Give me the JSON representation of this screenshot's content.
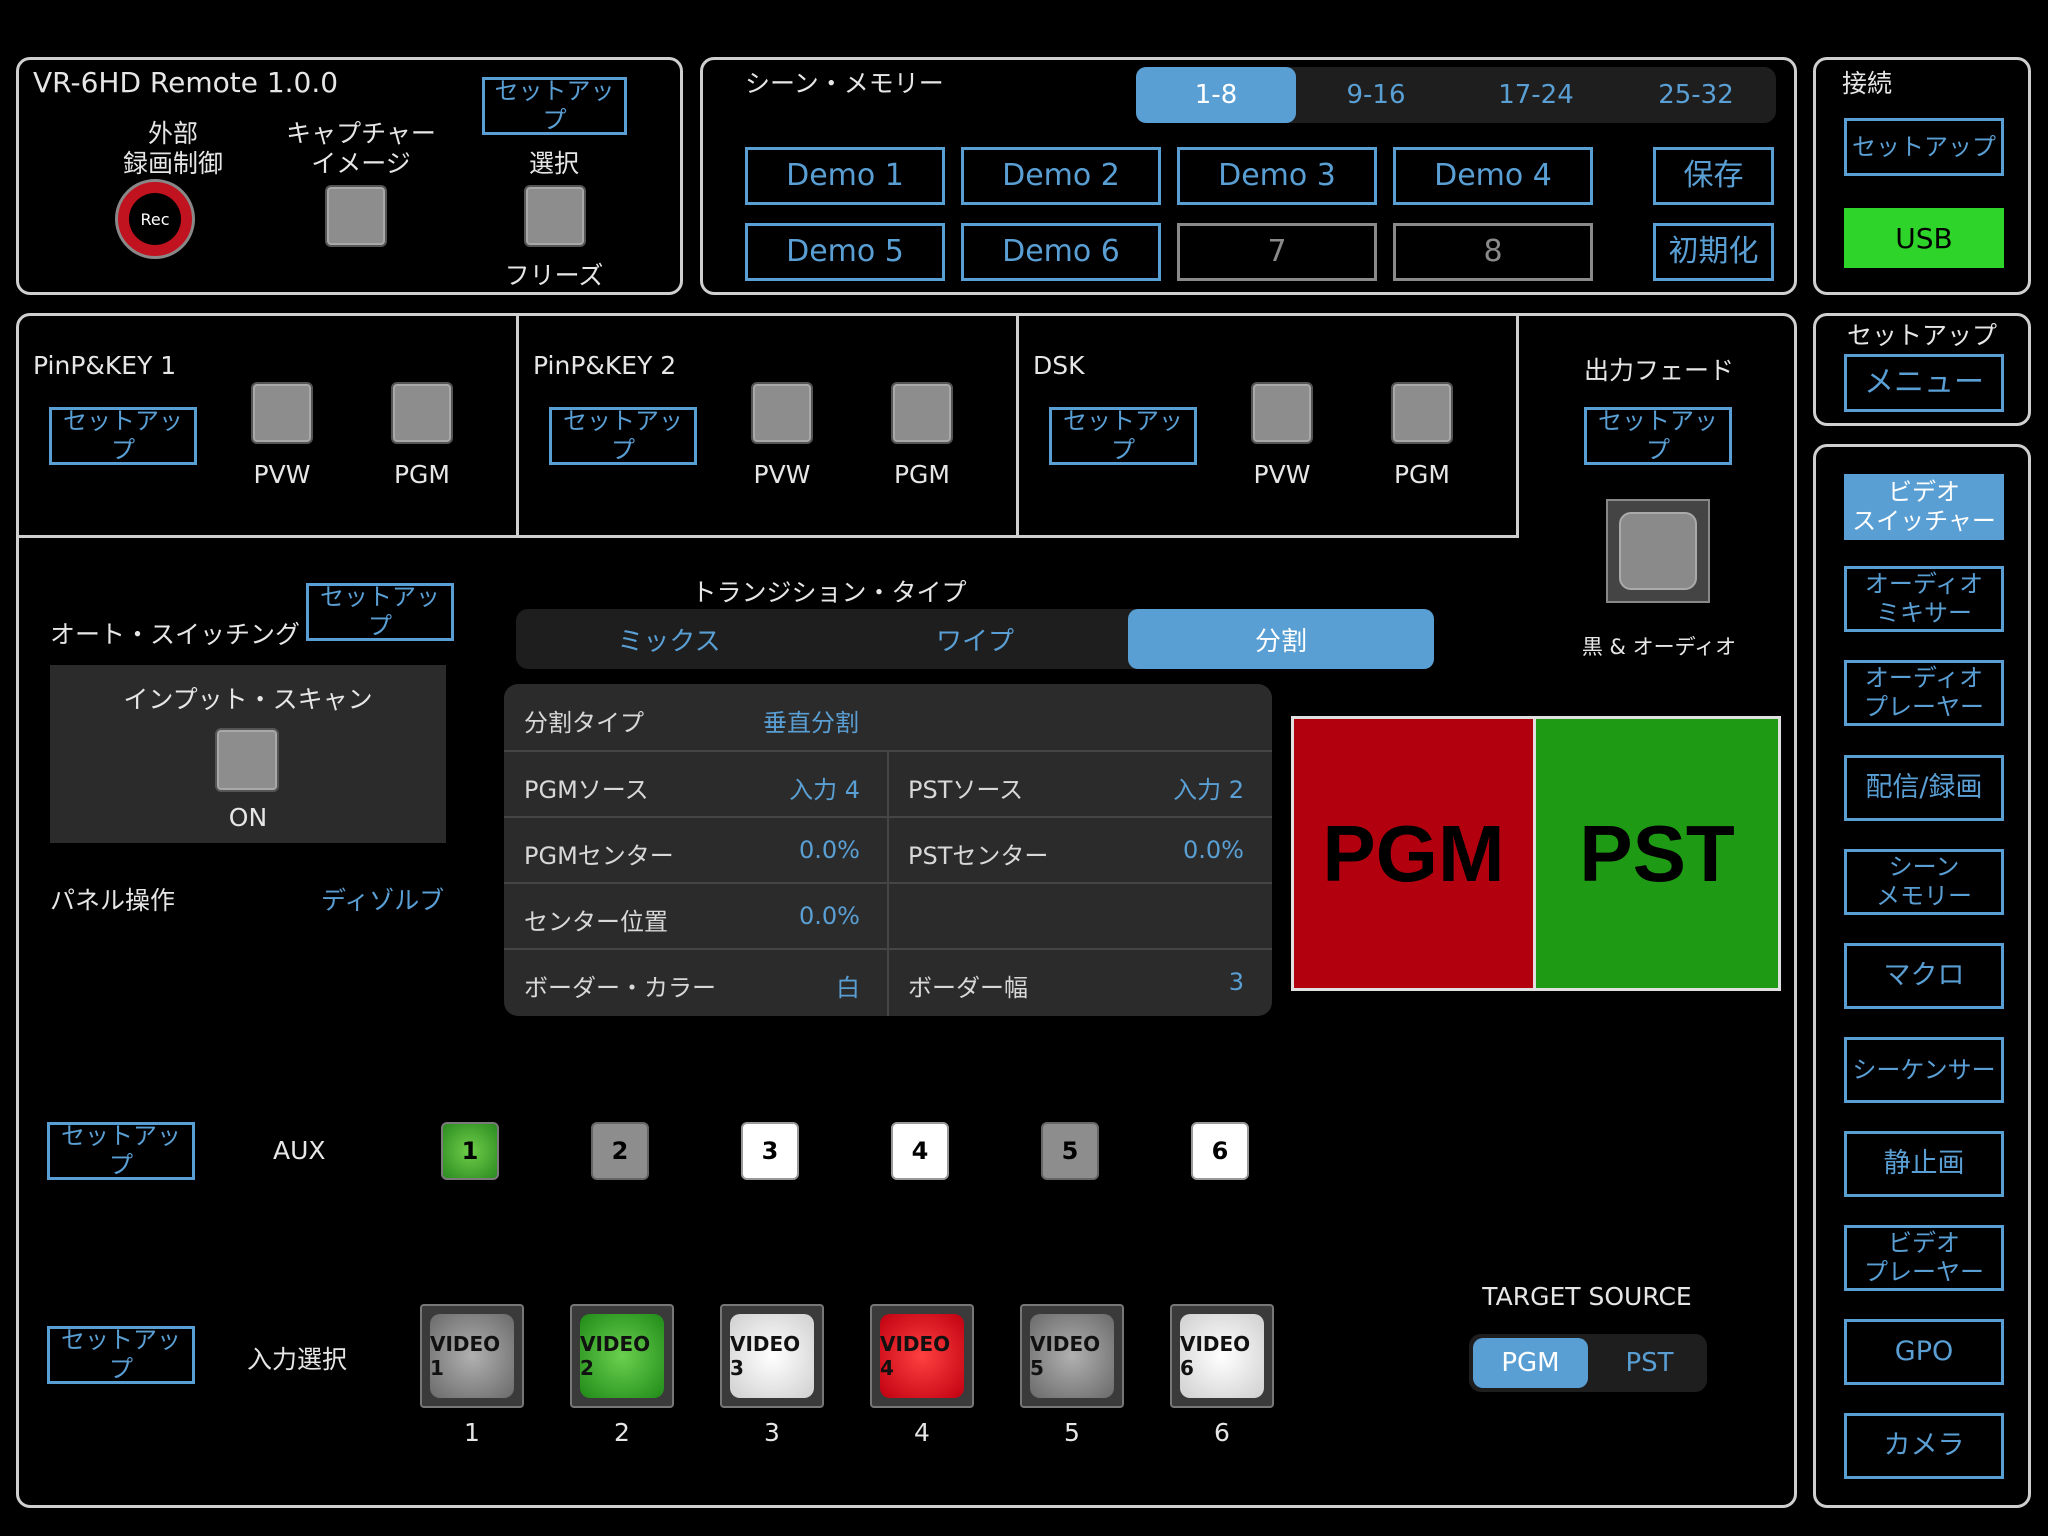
{
  "remote": {
    "title": "VR-6HD Remote 1.0.0",
    "setup": "セットアップ",
    "ext_rec_l1": "外部",
    "ext_rec_l2": "録画制御",
    "rec_label": "Rec",
    "capture_l1": "キャプチャー",
    "capture_l2": "イメージ",
    "select": "選択",
    "freeze": "フリーズ"
  },
  "scene_memory": {
    "title": "シーン・メモリー",
    "tabs": [
      "1-8",
      "9-16",
      "17-24",
      "25-32"
    ],
    "slots": [
      "Demo 1",
      "Demo 2",
      "Demo 3",
      "Demo 4",
      "Demo 5",
      "Demo 6",
      "7",
      "8"
    ],
    "save": "保存",
    "init": "初期化"
  },
  "connection": {
    "title": "接続",
    "setup": "セットアップ",
    "status": "USB"
  },
  "setup_menu": {
    "title": "セットアップ",
    "menu": "メニュー"
  },
  "nav": [
    {
      "l1": "ビデオ",
      "l2": "スイッチャー"
    },
    {
      "l1": "オーディオ",
      "l2": "ミキサー"
    },
    {
      "l1": "オーディオ",
      "l2": "プレーヤー"
    },
    {
      "l1": "配信/録画",
      "l2": ""
    },
    {
      "l1": "シーン",
      "l2": "メモリー"
    },
    {
      "l1": "マクロ",
      "l2": ""
    },
    {
      "l1": "シーケンサー",
      "l2": ""
    },
    {
      "l1": "静止画",
      "l2": ""
    },
    {
      "l1": "ビデオ",
      "l2": "プレーヤー"
    },
    {
      "l1": "GPO",
      "l2": ""
    },
    {
      "l1": "カメラ",
      "l2": ""
    }
  ],
  "keys": [
    {
      "title": "PinP&KEY 1",
      "setup": "セットアップ",
      "pvw": "PVW",
      "pgm": "PGM"
    },
    {
      "title": "PinP&KEY 2",
      "setup": "セットアップ",
      "pvw": "PVW",
      "pgm": "PGM"
    },
    {
      "title": "DSK",
      "setup": "セットアップ",
      "pvw": "PVW",
      "pgm": "PGM"
    }
  ],
  "output_fade": {
    "title": "出力フェード",
    "setup": "セットアップ",
    "caption": "黒 & オーディオ"
  },
  "auto_switching": {
    "title": "オート・スイッチング",
    "setup": "セットアップ",
    "scan_title": "インプット・スキャン",
    "scan_state": "ON",
    "panel_op_label": "パネル操作",
    "panel_op_value": "ディゾルブ"
  },
  "transition": {
    "title": "トランジション・タイプ",
    "tabs": [
      "ミックス",
      "ワイプ",
      "分割"
    ],
    "active": 2
  },
  "split": {
    "type_label": "分割タイプ",
    "type_value": "垂直分割",
    "pgm_src_label": "PGMソース",
    "pgm_src_value": "入力 4",
    "pst_src_label": "PSTソース",
    "pst_src_value": "入力 2",
    "pgm_center_label": "PGMセンター",
    "pgm_center_value": "0.0%",
    "pst_center_label": "PSTセンター",
    "pst_center_value": "0.0%",
    "center_pos_label": "センター位置",
    "center_pos_value": "0.0%",
    "border_color_label": "ボーダー・カラー",
    "border_color_value": "白",
    "border_width_label": "ボーダー幅",
    "border_width_value": "3"
  },
  "preview": {
    "left": "PGM",
    "right": "PST",
    "left_color": "#b3000f",
    "right_color": "#1f9a14"
  },
  "aux": {
    "setup": "セットアップ",
    "label": "AUX",
    "buttons": [
      "1",
      "2",
      "3",
      "4",
      "5",
      "6"
    ],
    "states": [
      "green",
      "grey",
      "white",
      "white",
      "grey",
      "white"
    ]
  },
  "input_select": {
    "setup": "セットアップ",
    "label": "入力選択",
    "buttons": [
      "VIDEO 1",
      "VIDEO 2",
      "VIDEO 3",
      "VIDEO 4",
      "VIDEO 5",
      "VIDEO 6"
    ],
    "numbers": [
      "1",
      "2",
      "3",
      "4",
      "5",
      "6"
    ],
    "states": [
      "grey",
      "green",
      "white",
      "red",
      "grey",
      "white"
    ]
  },
  "target_source": {
    "title": "TARGET SOURCE",
    "options": [
      "PGM",
      "PST"
    ],
    "active": 0
  }
}
